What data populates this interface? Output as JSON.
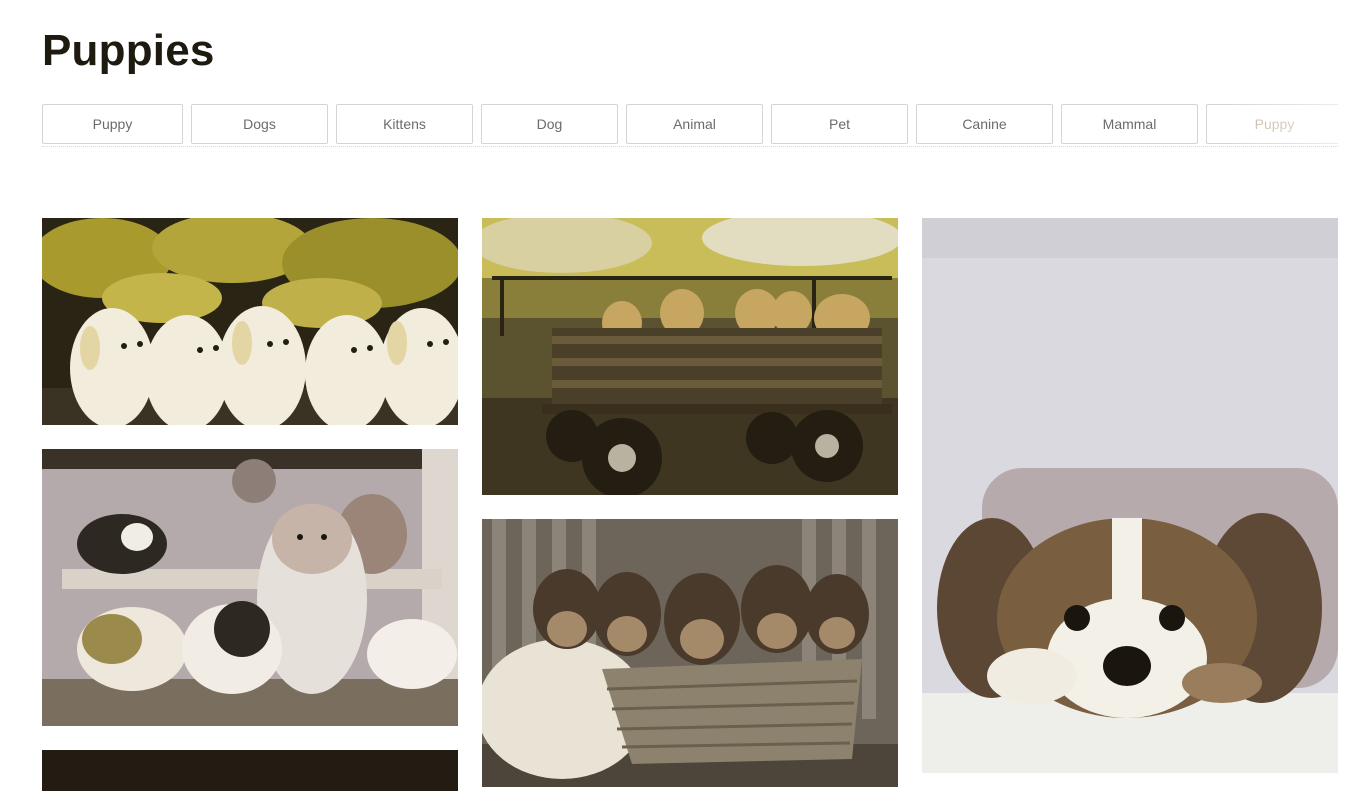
{
  "page": {
    "title": "Puppies"
  },
  "chips": [
    {
      "label": "Puppy"
    },
    {
      "label": "Dogs"
    },
    {
      "label": "Kittens"
    },
    {
      "label": "Dog"
    },
    {
      "label": "Animal"
    },
    {
      "label": "Pet"
    },
    {
      "label": "Canine"
    },
    {
      "label": "Mammal"
    },
    {
      "label": "Puppy"
    }
  ],
  "photos": [
    {
      "subject": "five golden retriever puppies in a row"
    },
    {
      "subject": "puppies in a wooden wagon"
    },
    {
      "subject": "cavalier king charles spaniel puppy resting"
    },
    {
      "subject": "australian shepherd puppies on steps"
    },
    {
      "subject": "fluffy puppies in a wicker basket"
    },
    {
      "subject": "dark photo, partially visible"
    }
  ],
  "colors": {
    "title": "#1f1a0f",
    "chip_text": "#6b6b6b",
    "chip_border": "#d4d4d4"
  }
}
